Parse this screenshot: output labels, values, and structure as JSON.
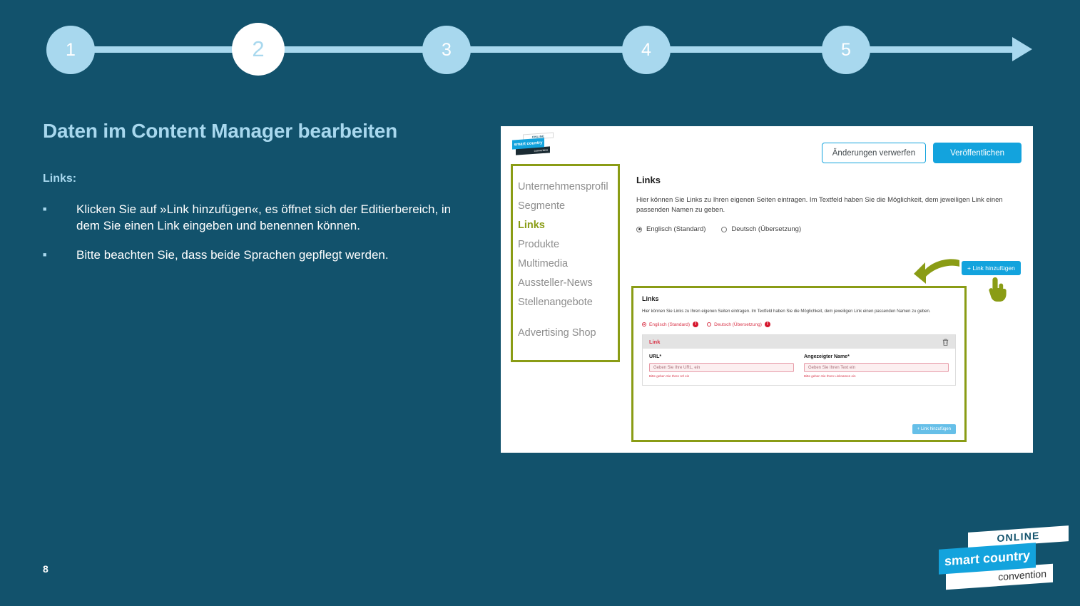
{
  "stepper": {
    "steps": [
      {
        "label": "1",
        "active": false
      },
      {
        "label": "2",
        "active": true
      },
      {
        "label": "3",
        "active": false
      },
      {
        "label": "4",
        "active": false
      },
      {
        "label": "5",
        "active": false
      }
    ]
  },
  "slide": {
    "title": "Daten im Content Manager bearbeiten",
    "section_label": "Links:",
    "bullets": [
      "Klicken Sie auf »Link hinzufügen«, es öffnet sich der Editierbereich, in dem Sie einen Link eingeben und benennen können.",
      "Bitte beachten Sie, dass beide Sprachen gepflegt werden."
    ],
    "page_number": "8"
  },
  "brand_logo": {
    "online": "ONLINE",
    "smart_country": "smart country",
    "convention": "convention"
  },
  "app": {
    "logo": {
      "online": "ONLINE",
      "smart_country": "smart country",
      "convention": "convention"
    },
    "actions": {
      "discard": "Änderungen verwerfen",
      "publish": "Veröffentlichen"
    },
    "nav": {
      "items": [
        {
          "label": "Unternehmensprofil",
          "active": false
        },
        {
          "label": "Segmente",
          "active": false
        },
        {
          "label": "Links",
          "active": true
        },
        {
          "label": "Produkte",
          "active": false
        },
        {
          "label": "Multimedia",
          "active": false
        },
        {
          "label": "Aussteller-News",
          "active": false
        },
        {
          "label": "Stellenangebote",
          "active": false
        }
      ],
      "secondary": "Advertising Shop"
    },
    "main": {
      "heading": "Links",
      "description": "Hier können Sie Links zu Ihren eigenen Seiten eintragen. Im Textfeld haben Sie die Möglichkeit, dem jeweiligen Link einen passenden Namen zu geben.",
      "lang_default": "Englisch (Standard)",
      "lang_translation": "Deutsch (Übersetzung)",
      "add_link_button": "+ Link hinzufügen"
    },
    "editor": {
      "heading": "Links",
      "description": "Hier können Sie Links zu Ihren eigenen Seiten eintragen. Im Textfeld haben Sie die Möglichkeit, dem jeweiligen Link einen passenden Namen zu geben.",
      "lang_default": "Englisch (Standard)",
      "lang_translation": "Deutsch (Übersetzung)",
      "error_badge": "!",
      "card_title": "Link",
      "url_label": "URL*",
      "url_placeholder": "Geben Sie Ihre URL, ein",
      "url_error": "Bitte geben Sie Ihren Url ein",
      "name_label": "Angezeigter Name*",
      "name_placeholder": "Geben Sie Ihren Text ein",
      "name_error": "Bitte geben Sie Ihren Linknamen ein",
      "add_link_button": "+ Link hinzufügen",
      "delete_icon": "trash-icon"
    }
  },
  "colors": {
    "background": "#12526c",
    "accent_light_blue": "#a8d8ee",
    "brand_cyan": "#13a3dd",
    "highlight_olive": "#8a9c15",
    "error_red": "#d9364a"
  }
}
